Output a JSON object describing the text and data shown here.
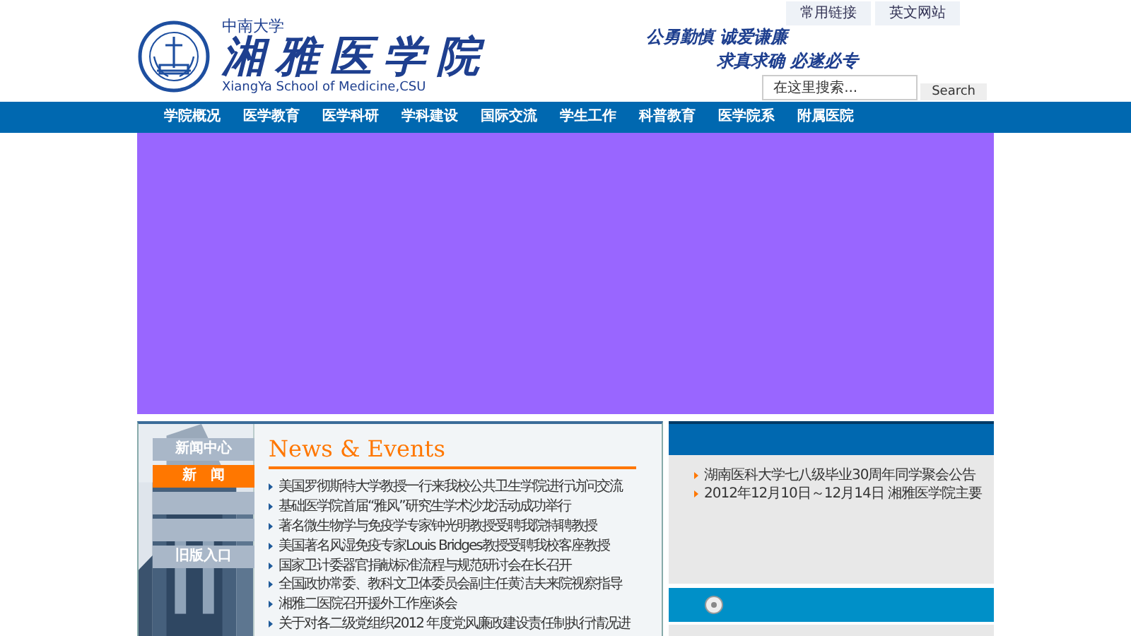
{
  "header": {
    "university": "中南大学",
    "school": "湘雅医学院",
    "english": "XiangYa School of Medicine,CSU",
    "top_links": [
      "常用链接",
      "英文网站"
    ],
    "motto": [
      "公勇勤慎 诚爱谦廉",
      "求真求确 必遂必专"
    ],
    "search": {
      "placeholder": "在这里搜索...",
      "button": "Search"
    }
  },
  "nav": [
    "学院概况",
    "医学教育",
    "医学科研",
    "学科建设",
    "国际交流",
    "学生工作",
    "科普教育",
    "医学院系",
    "附属医院"
  ],
  "sidebar": [
    {
      "label": "新闻中心",
      "selected": false
    },
    {
      "label": "新　闻",
      "selected": true
    },
    {
      "selected": false
    },
    {
      "selected": false
    },
    {
      "label": "旧版入口",
      "selected": false
    }
  ],
  "news": {
    "title": "News & Events",
    "items": [
      "美国罗彻斯特大学教授一行来我校公共卫生学院进行访问交流",
      "基础医学院首届“雅风”研究生学术沙龙活动成功举行",
      "著名微生物学与免疫学专家钟光明教授受聘我院特聘教授",
      "美国著名风湿免疫专家Louis Bridges教授受聘我校客座教授",
      "国家卫计委器官捐献标准流程与规范研讨会在长召开",
      "全国政协常委、教科文卫体委员会副主任黄洁夫来院视察指导",
      "湘雅二医院召开援外工作座谈会",
      "关于对各二级党组织2012 年度党风廉政建设责任制执行情况进"
    ]
  },
  "notices": [
    "湖南医科大学七八级毕业30周年同学聚会公告",
    "2012年12月10日～12月14日 湘雅医学院主要"
  ]
}
